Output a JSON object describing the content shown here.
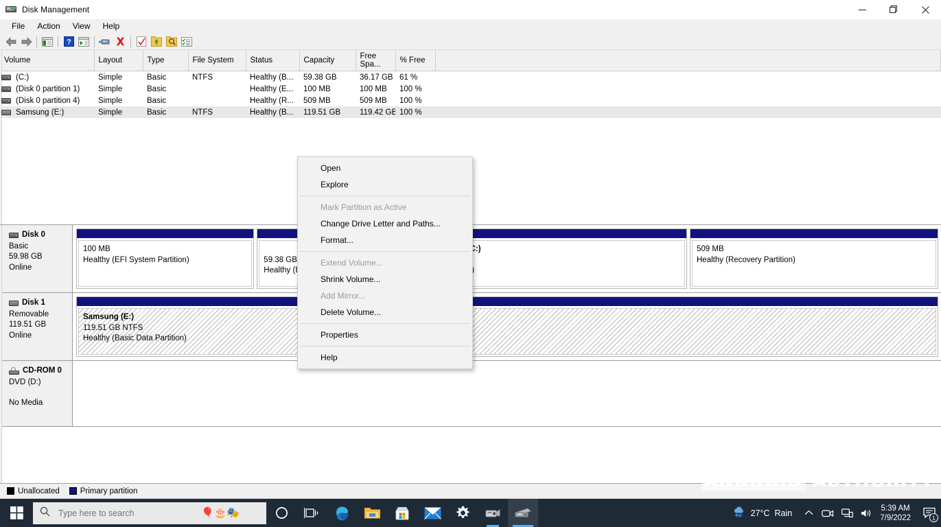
{
  "window": {
    "title": "Disk Management",
    "icon": "disk-management-icon",
    "controls": {
      "minimize": "—",
      "maximize": "❐",
      "close": "✕"
    }
  },
  "menubar": {
    "items": [
      "File",
      "Action",
      "View",
      "Help"
    ]
  },
  "toolbar": {
    "buttons": [
      {
        "name": "back-icon",
        "label": "Back"
      },
      {
        "name": "forward-icon",
        "label": "Forward"
      },
      {
        "name": "show-hide-console-tree-icon",
        "label": "Show/Hide Console Tree"
      },
      {
        "name": "help-icon",
        "label": "Help"
      },
      {
        "name": "show-hide-action-pane-icon",
        "label": "Show/Hide Action Pane"
      },
      {
        "name": "rescan-disks-icon",
        "label": "Rescan Disks"
      },
      {
        "name": "delete-icon",
        "label": "Delete"
      },
      {
        "name": "properties-icon",
        "label": "Properties"
      },
      {
        "name": "export-list-icon",
        "label": "Export List"
      },
      {
        "name": "find-icon",
        "label": "Find"
      },
      {
        "name": "task-list-icon",
        "label": "Task List"
      }
    ]
  },
  "volume_list": {
    "columns": [
      "Volume",
      "Layout",
      "Type",
      "File System",
      "Status",
      "Capacity",
      "Free Spa...",
      "% Free"
    ],
    "rows": [
      {
        "volume": "(C:)",
        "icon": "volume-icon",
        "layout": "Simple",
        "type": "Basic",
        "file_system": "NTFS",
        "status": "Healthy (B...",
        "capacity": "59.38 GB",
        "free_space": "36.17 GB",
        "percent_free": "61 %",
        "selected": false
      },
      {
        "volume": "(Disk 0 partition 1)",
        "icon": "volume-icon",
        "layout": "Simple",
        "type": "Basic",
        "file_system": "",
        "status": "Healthy (E...",
        "capacity": "100 MB",
        "free_space": "100 MB",
        "percent_free": "100 %",
        "selected": false
      },
      {
        "volume": "(Disk 0 partition 4)",
        "icon": "volume-icon",
        "layout": "Simple",
        "type": "Basic",
        "file_system": "",
        "status": "Healthy (R...",
        "capacity": "509 MB",
        "free_space": "509 MB",
        "percent_free": "100 %",
        "selected": false
      },
      {
        "volume": "Samsung (E:)",
        "icon": "volume-icon",
        "layout": "Simple",
        "type": "Basic",
        "file_system": "NTFS",
        "status": "Healthy (B...",
        "capacity": "119.51 GB",
        "free_space": "119.42 GB",
        "percent_free": "100 %",
        "selected": true
      }
    ]
  },
  "graphical_view": {
    "disks": [
      {
        "name": "Disk 0",
        "icon": "disk-icon",
        "type": "Basic",
        "size": "59.98 GB",
        "status": "Online",
        "partitions": [
          {
            "label": "",
            "size_line": "100 MB",
            "status_line": "Healthy (EFI System Partition)",
            "flex": 243,
            "selected": false
          },
          {
            "label": "(C:)",
            "size_line": "59.38 GB NTFS",
            "status_line": "Healthy (Boot, Page File, Crash Dump, Basic Data Partition)",
            "flex": 590,
            "selected": false
          },
          {
            "label": "",
            "size_line": "509 MB",
            "status_line": "Healthy (Recovery Partition)",
            "flex": 340,
            "selected": false
          }
        ]
      },
      {
        "name": "Disk 1",
        "icon": "disk-icon",
        "type": "Removable",
        "size": "119.51 GB",
        "status": "Online",
        "partitions": [
          {
            "label": "Samsung  (E:)",
            "size_line": "119.51 GB NTFS",
            "status_line": "Healthy (Basic Data Partition)",
            "flex": 1000,
            "selected": true
          }
        ]
      },
      {
        "name": "CD-ROM 0",
        "icon": "cdrom-icon",
        "type": "DVD (D:)",
        "size": "",
        "status": "No Media",
        "partitions": []
      }
    ]
  },
  "legend": {
    "items": [
      {
        "label": "Unallocated",
        "color": "#000000"
      },
      {
        "label": "Primary partition",
        "color": "#12127e"
      }
    ]
  },
  "context_menu": {
    "items": [
      {
        "label": "Open",
        "disabled": false,
        "separator_after": false
      },
      {
        "label": "Explore",
        "disabled": false,
        "separator_after": true
      },
      {
        "label": "Mark Partition as Active",
        "disabled": true,
        "separator_after": false
      },
      {
        "label": "Change Drive Letter and Paths...",
        "disabled": false,
        "separator_after": false
      },
      {
        "label": "Format...",
        "disabled": false,
        "separator_after": true
      },
      {
        "label": "Extend Volume...",
        "disabled": true,
        "separator_after": false
      },
      {
        "label": "Shrink Volume...",
        "disabled": false,
        "separator_after": false
      },
      {
        "label": "Add Mirror...",
        "disabled": true,
        "separator_after": false
      },
      {
        "label": "Delete Volume...",
        "disabled": false,
        "separator_after": true
      },
      {
        "label": "Properties",
        "disabled": false,
        "separator_after": true
      },
      {
        "label": "Help",
        "disabled": false,
        "separator_after": false
      }
    ]
  },
  "watermark": {
    "word1": "ANDROID",
    "word2": "AUTHORITY"
  },
  "taskbar": {
    "start": "start-icon",
    "search_placeholder": "Type here to search",
    "search_value": "",
    "icons": [
      {
        "name": "cortana-icon",
        "state": "none"
      },
      {
        "name": "task-view-icon",
        "state": "none"
      },
      {
        "name": "microsoft-edge-icon",
        "state": "none"
      },
      {
        "name": "file-explorer-icon",
        "state": "none"
      },
      {
        "name": "microsoft-store-icon",
        "state": "none"
      },
      {
        "name": "mail-icon",
        "state": "none"
      },
      {
        "name": "settings-icon",
        "state": "none"
      },
      {
        "name": "computer-management-icon",
        "state": "running"
      },
      {
        "name": "disk-management-icon",
        "state": "active"
      }
    ],
    "tray": {
      "weather_temp": "27°C",
      "weather_condition": "Rain",
      "chevron": "show-hidden-icons-icon",
      "meet_now": "meet-now-icon",
      "network": "network-icon",
      "volume": "volume-icon",
      "time": "5:39 AM",
      "date": "7/9/2022",
      "notification_count": "1"
    }
  }
}
